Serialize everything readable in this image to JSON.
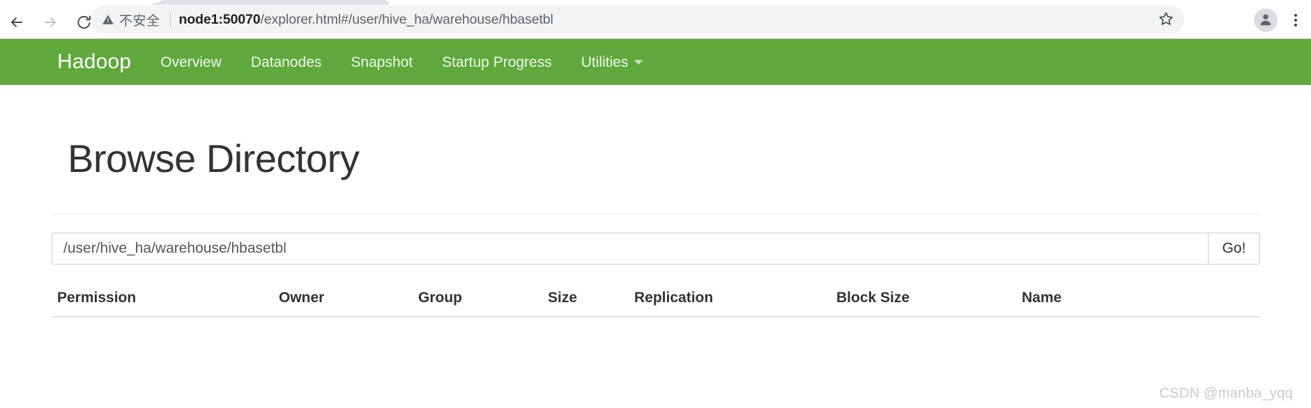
{
  "browser": {
    "back_icon": "back-arrow-icon",
    "forward_icon": "forward-arrow-icon",
    "reload_icon": "reload-icon",
    "security_warning_icon": "warning-triangle-icon",
    "security_label": "不安全",
    "url_host": "node1:50070",
    "url_path": "/explorer.html#/user/hive_ha/warehouse/hbasetbl",
    "url_full": "node1:50070/explorer.html#/user/hive_ha/warehouse/hbasetbl",
    "bookmark_icon": "star-outline-icon",
    "profile_icon": "person-avatar-icon",
    "menu_icon": "three-dots-vertical-icon"
  },
  "navbar": {
    "brand": "Hadoop",
    "brand_color": "#ffffff",
    "background_color": "#5fa83c",
    "items": [
      {
        "label": "Overview",
        "has_caret": false
      },
      {
        "label": "Datanodes",
        "has_caret": false
      },
      {
        "label": "Snapshot",
        "has_caret": false
      },
      {
        "label": "Startup Progress",
        "has_caret": false
      },
      {
        "label": "Utilities",
        "has_caret": true
      }
    ]
  },
  "main": {
    "title": "Browse Directory",
    "path_input": {
      "value": "/user/hive_ha/warehouse/hbasetbl",
      "placeholder": "Enter a path"
    },
    "go_button_label": "Go!",
    "table": {
      "columns": [
        "Permission",
        "Owner",
        "Group",
        "Size",
        "Replication",
        "Block Size",
        "Name"
      ],
      "rows": []
    }
  },
  "watermark": {
    "text": "CSDN @manba_yqq"
  }
}
